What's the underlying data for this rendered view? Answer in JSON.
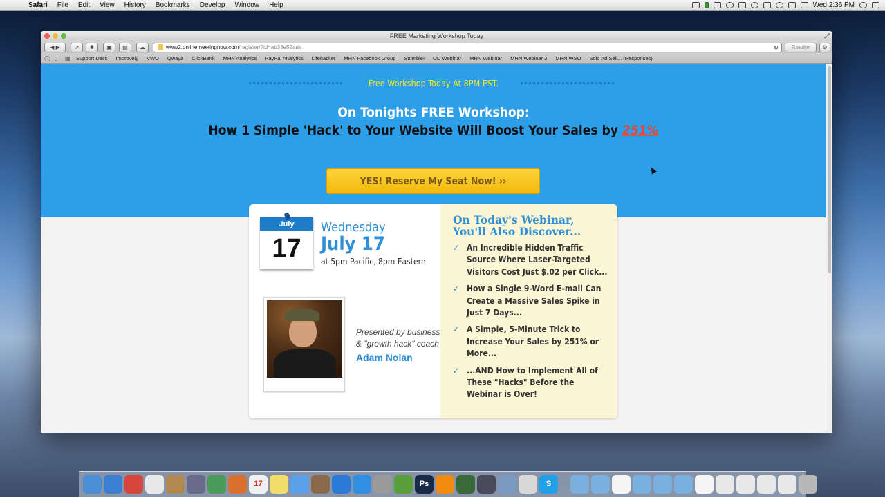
{
  "menubar": {
    "apple": "",
    "items": [
      "Safari",
      "File",
      "Edit",
      "View",
      "History",
      "Bookmarks",
      "Develop",
      "Window",
      "Help"
    ],
    "clock": "Wed 2:36 PM"
  },
  "window": {
    "title": "FREE Marketing Workshop Today",
    "address_host": "www2.onlinemeetingnow.com",
    "address_path": "/register/?id=ab33e52ade",
    "reader": "Reader",
    "bookmarks": [
      "Support Desk",
      "Improvely",
      "VWO",
      "Qwaya",
      "ClickBank",
      "MHN Analytics",
      "PayPal Analytics",
      "Lifehacker",
      "MHN Facebook Group",
      "Stumble!",
      "OD Webinar",
      "MHN Webinar",
      "MHN Webinar 2",
      "MHN WSO",
      "Solo Ad Sell... (Responses)"
    ]
  },
  "page": {
    "topline": "Free Workshop Today At 8PM EST.",
    "headline1": "On Tonights FREE Workshop:",
    "headline2": "How 1 Simple 'Hack' to Your Website Will Boost Your Sales by",
    "headline2_pct": "251%",
    "cta": "YES! Reserve My Seat Now! ››",
    "calendar_month": "July",
    "calendar_day": "17",
    "day_name": "Wednesday",
    "date_big": "July 17",
    "time": "at 5pm Pacific, 8pm Eastern",
    "presented_line1": "Presented by business",
    "presented_line2": "& \"growth hack\" coach",
    "speaker": "Adam Nolan",
    "discover_title_1": "On Today's Webinar,",
    "discover_title_2": "You'll Also Discover...",
    "bullets": [
      {
        "line1": "An Incredible Hidden Traffic",
        "line2": "Source Where Laser-Targeted",
        "line3": "Visitors Cost Just $.02 per Click..."
      },
      {
        "line1": "How a Single 9-Word E-mail Can",
        "line2": "Create a Massive Sales Spike in",
        "line3": "Just 7 Days..."
      },
      {
        "line1": "A Simple, 5-Minute Trick to",
        "line2": "Increase Your Sales by 251% or",
        "line3": "More..."
      },
      {
        "line1": "...AND How to Implement All of",
        "line2": "These \"Hacks\" Before the",
        "line3": "Webinar is Over!"
      }
    ],
    "check": "✓"
  },
  "dock": {
    "icons": [
      {
        "name": "finder-icon",
        "color": "#4a8fd8",
        "label": ""
      },
      {
        "name": "safari-icon",
        "color": "#3a7fd0",
        "label": ""
      },
      {
        "name": "chrome-icon",
        "color": "#d8453a",
        "label": ""
      },
      {
        "name": "textedit-icon",
        "color": "#e8e8e8",
        "label": ""
      },
      {
        "name": "contacts-icon",
        "color": "#b08850",
        "label": ""
      },
      {
        "name": "pen-icon",
        "color": "#6a6a8a",
        "label": ""
      },
      {
        "name": "numbers-icon",
        "color": "#4a9a5a",
        "label": ""
      },
      {
        "name": "presentation-icon",
        "color": "#d87030",
        "label": ""
      },
      {
        "name": "calendar-icon",
        "color": "#f0f0f0",
        "label": "17"
      },
      {
        "name": "notes-icon",
        "color": "#f2dc6a",
        "label": ""
      },
      {
        "name": "messages-icon",
        "color": "#5aa0e8",
        "label": ""
      },
      {
        "name": "photo-icon",
        "color": "#8a6a4a",
        "label": ""
      },
      {
        "name": "itunes-icon",
        "color": "#2a7ad8",
        "label": ""
      },
      {
        "name": "app-store-icon",
        "color": "#2f8fe0",
        "label": ""
      },
      {
        "name": "disk-utility-icon",
        "color": "#9a9a9a",
        "label": ""
      },
      {
        "name": "evernote-icon",
        "color": "#5aa03a",
        "label": ""
      },
      {
        "name": "photoshop-icon",
        "color": "#1a2a4a",
        "label": "Ps"
      },
      {
        "name": "vlc-icon",
        "color": "#f08a10",
        "label": ""
      },
      {
        "name": "book-icon",
        "color": "#3a6a3a",
        "label": ""
      },
      {
        "name": "video-editor-icon",
        "color": "#4a4a5a",
        "label": ""
      },
      {
        "name": "preview-icon",
        "color": "#7a9ac0",
        "label": ""
      },
      {
        "name": "script-icon",
        "color": "#d8d8d8",
        "label": ""
      },
      {
        "name": "skype-icon",
        "color": "#20a0e8",
        "label": "S"
      },
      {
        "name": "folder-icon",
        "color": "#7ab0e0",
        "label": ""
      },
      {
        "name": "folder-icon",
        "color": "#7ab0e0",
        "label": ""
      },
      {
        "name": "document-icon",
        "color": "#f5f5f5",
        "label": ""
      },
      {
        "name": "folder-icon",
        "color": "#7ab0e0",
        "label": ""
      },
      {
        "name": "folder-icon",
        "color": "#7ab0e0",
        "label": ""
      },
      {
        "name": "folder-icon",
        "color": "#7ab0e0",
        "label": ""
      },
      {
        "name": "document-icon",
        "color": "#f5f5f5",
        "label": ""
      },
      {
        "name": "screenshot-icon",
        "color": "#e8e8e8",
        "label": ""
      },
      {
        "name": "screenshot-icon",
        "color": "#e8e8e8",
        "label": ""
      },
      {
        "name": "screenshot-icon",
        "color": "#e8e8e8",
        "label": ""
      },
      {
        "name": "screenshot-icon",
        "color": "#e8e8e8",
        "label": ""
      },
      {
        "name": "trash-icon",
        "color": "#b8b8b8",
        "label": ""
      }
    ]
  }
}
